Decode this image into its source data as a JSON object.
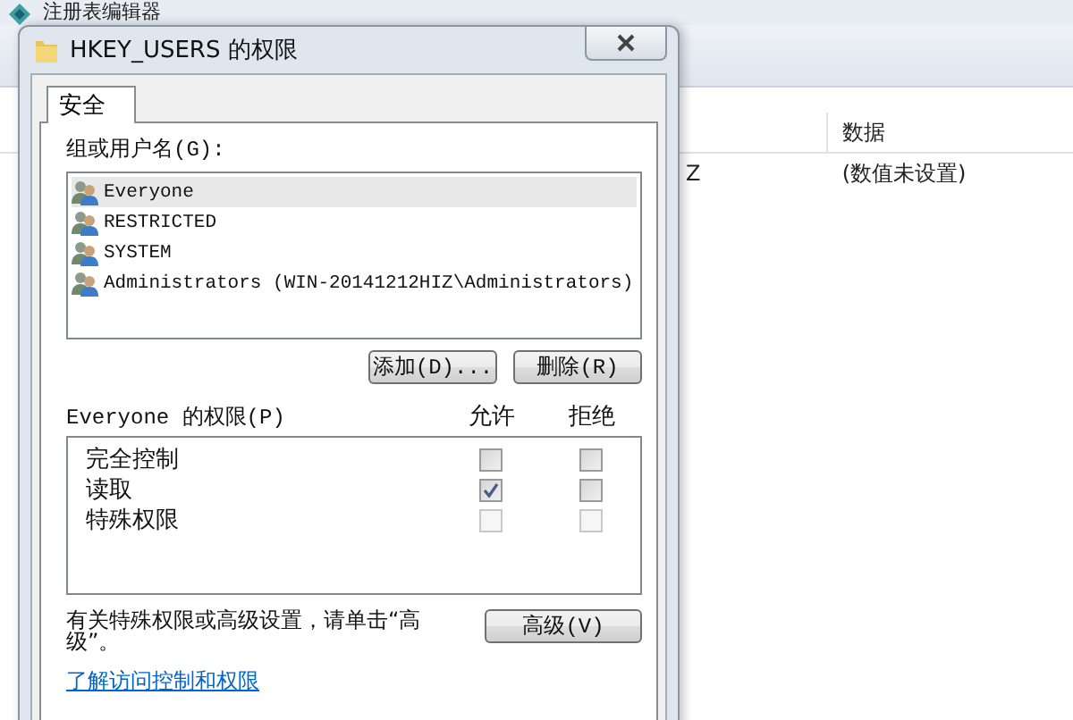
{
  "background_window": {
    "title": "注册表编辑器",
    "columns": [
      "数据"
    ],
    "rows": [
      {
        "name_tail": "Z",
        "data": "(数值未设置)"
      }
    ]
  },
  "dialog": {
    "title": "HKEY_USERS 的权限",
    "tabs": [
      {
        "label": "安全",
        "selected": true
      }
    ],
    "users_label": "组或用户名(G):",
    "users": [
      {
        "name": "Everyone",
        "selected": true
      },
      {
        "name": "RESTRICTED",
        "selected": false
      },
      {
        "name": "SYSTEM",
        "selected": false
      },
      {
        "name": "Administrators (WIN-20141212HIZ\\Administrators)",
        "selected": false
      }
    ],
    "user_buttons": [
      "添加(D)...",
      "删除(R)"
    ],
    "permissions_label": "Everyone 的权限(P)",
    "permission_columns": [
      "允许",
      "拒绝"
    ],
    "permissions": [
      {
        "label": "完全控制",
        "allow": {
          "checked": false,
          "disabled": false
        },
        "deny": {
          "checked": false,
          "disabled": false
        }
      },
      {
        "label": "读取",
        "allow": {
          "checked": true,
          "disabled": false
        },
        "deny": {
          "checked": false,
          "disabled": false
        }
      },
      {
        "label": "特殊权限",
        "allow": {
          "checked": false,
          "disabled": true
        },
        "deny": {
          "checked": false,
          "disabled": true
        }
      }
    ],
    "advanced_note": "有关特殊权限或高级设置，请单击“高级”。",
    "advanced_button": "高级(V)",
    "help_link": "了解访问控制和权限"
  }
}
